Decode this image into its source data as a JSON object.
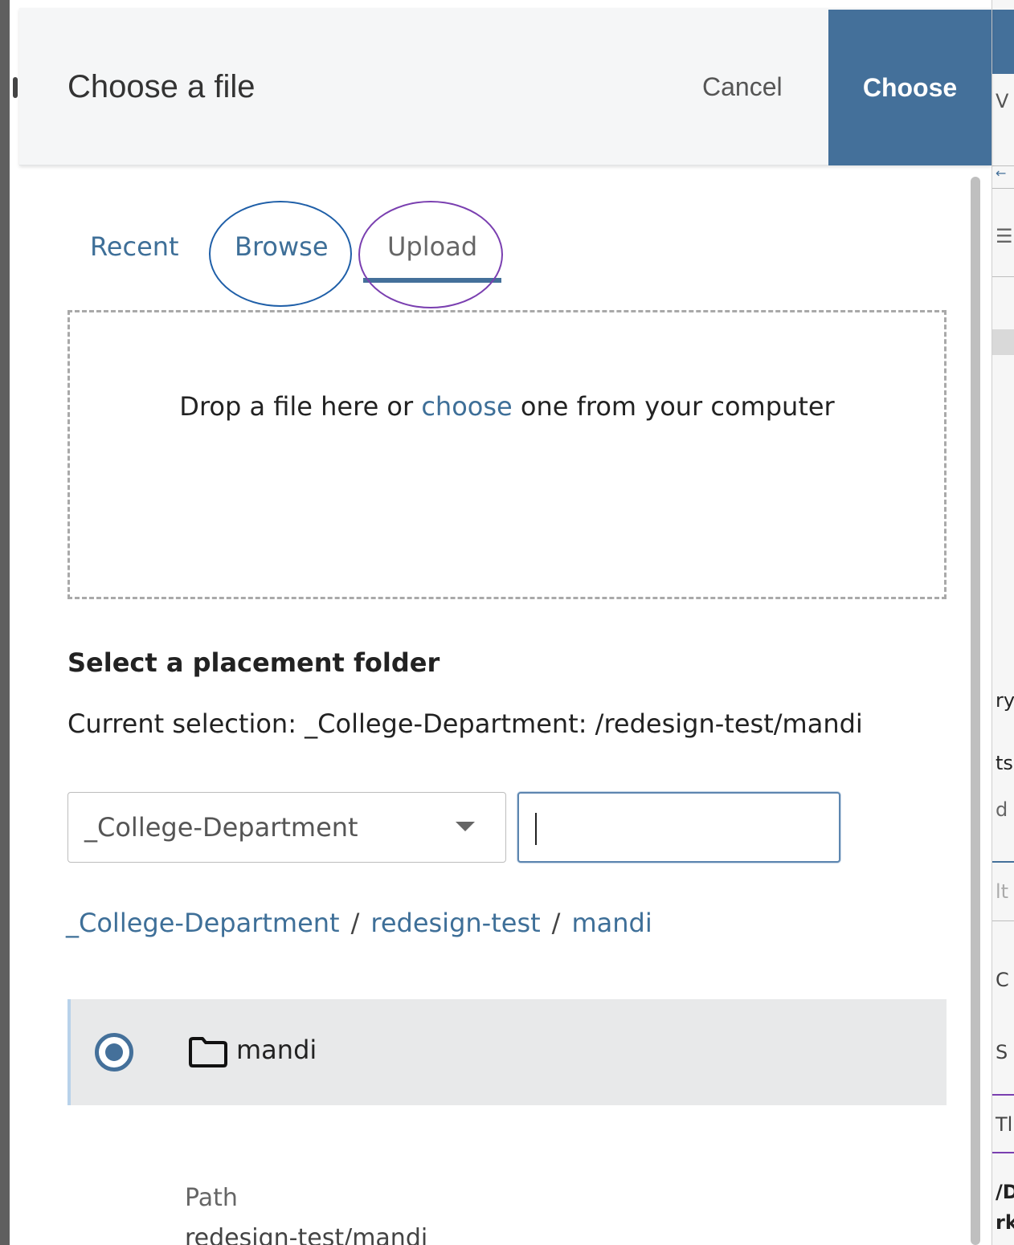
{
  "dialog": {
    "title": "Choose a file",
    "cancel_label": "Cancel",
    "choose_label": "Choose"
  },
  "tabs": [
    {
      "label": "Recent",
      "active": false
    },
    {
      "label": "Browse",
      "active": false
    },
    {
      "label": "Upload",
      "active": true
    }
  ],
  "dropzone": {
    "text_before": "Drop a file here or ",
    "link": "choose",
    "text_after": " one from your computer"
  },
  "placement": {
    "heading": "Select a placement folder",
    "current_selection": "Current selection: _College-Department: /redesign-test/mandi",
    "site_select_value": "_College-Department",
    "search_value": ""
  },
  "breadcrumb": [
    "_College-Department",
    "redesign-test",
    "mandi"
  ],
  "breadcrumb_separator": "/",
  "folder_list": [
    {
      "name": "mandi",
      "selected": true
    }
  ],
  "details": {
    "path_label": "Path",
    "path_value": "redesign-test/mandi"
  },
  "background_app": {
    "fragments": [
      "V",
      "←",
      "☰",
      "ry",
      "ts",
      "d",
      "lt",
      "C",
      "S",
      "Tl",
      "/D",
      "rk"
    ]
  },
  "colors": {
    "accent": "#44709a",
    "link": "#3e6f98",
    "annotation_blue": "#1f5fa8",
    "annotation_purple": "#7a3fb0"
  }
}
